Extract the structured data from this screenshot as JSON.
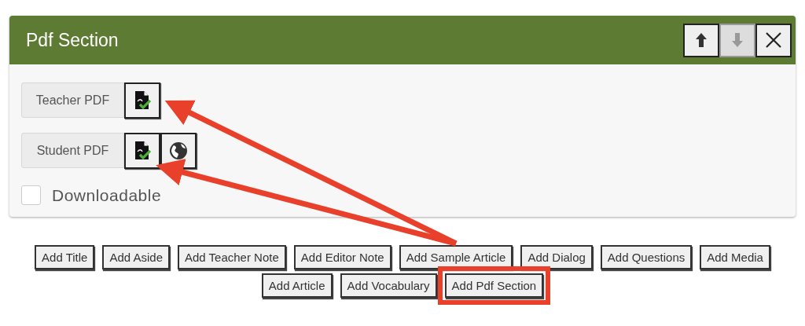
{
  "panel": {
    "title": "Pdf Section",
    "header_buttons": [
      {
        "kind": "up",
        "disabled": false
      },
      {
        "kind": "down",
        "disabled": true
      },
      {
        "kind": "close",
        "disabled": false
      }
    ],
    "pdf_fields": [
      {
        "label": "Teacher PDF",
        "uploaded": true,
        "has_link": false
      },
      {
        "label": "Student PDF",
        "uploaded": true,
        "has_link": true
      }
    ],
    "downloadable": {
      "label": "Downloadable",
      "checked": false
    }
  },
  "add_buttons": [
    {
      "label": "Add Title",
      "highlighted": false
    },
    {
      "label": "Add Aside",
      "highlighted": false
    },
    {
      "label": "Add Teacher Note",
      "highlighted": false
    },
    {
      "label": "Add Editor Note",
      "highlighted": false
    },
    {
      "label": "Add Sample Article",
      "highlighted": false
    },
    {
      "label": "Add Dialog",
      "highlighted": false
    },
    {
      "label": "Add Questions",
      "highlighted": false
    },
    {
      "label": "Add Media",
      "highlighted": false
    },
    {
      "label": "Add Article",
      "highlighted": false
    },
    {
      "label": "Add Vocabulary",
      "highlighted": false
    },
    {
      "label": "Add Pdf Section",
      "highlighted": true
    }
  ]
}
